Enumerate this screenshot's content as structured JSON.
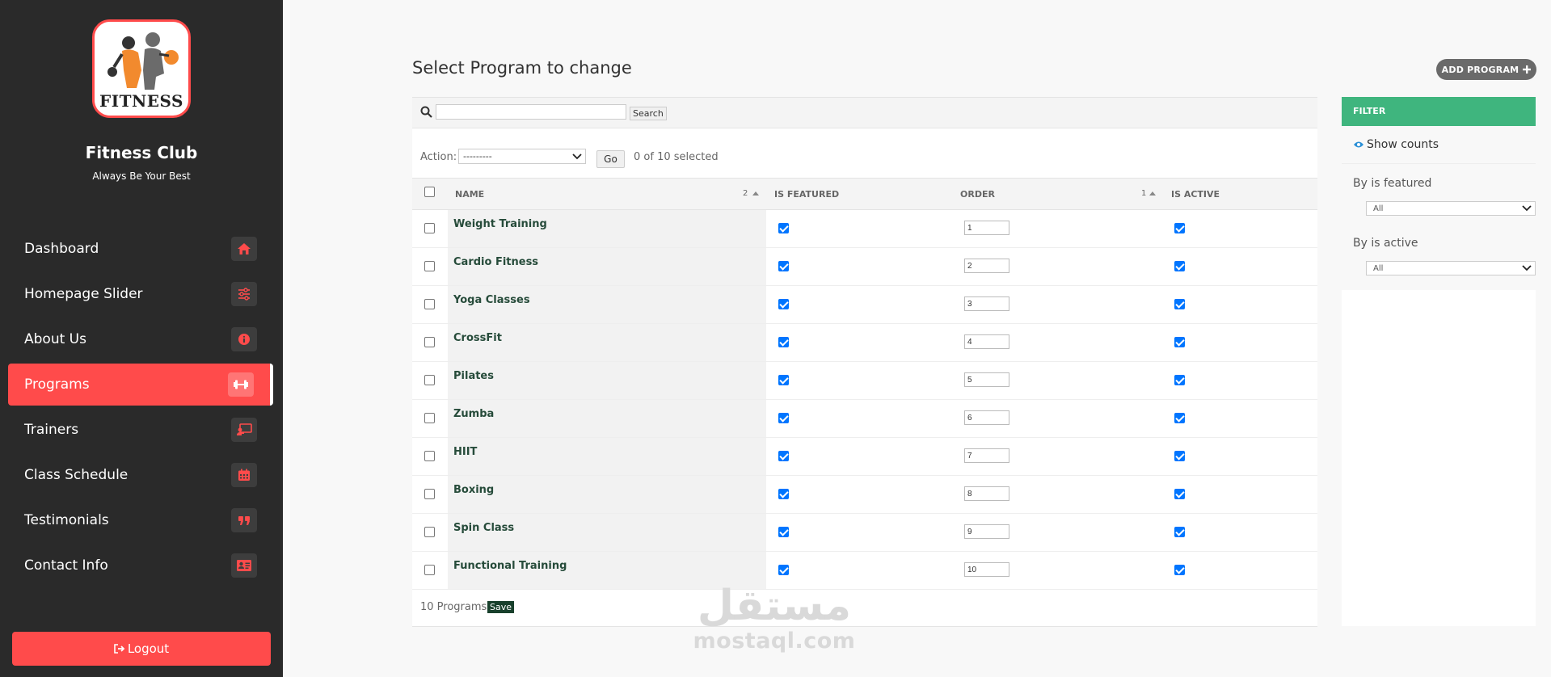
{
  "brand": {
    "name": "Fitness Club",
    "tagline": "Always Be Your Best",
    "logo_text": "FITNESS"
  },
  "colors": {
    "sidebar": "#2a2a2a",
    "accent": "#ff4b4b",
    "filter_header": "#3fb57e",
    "save": "#18402c"
  },
  "nav": {
    "items": [
      {
        "label": "Dashboard",
        "icon": "home-icon"
      },
      {
        "label": "Homepage Slider",
        "icon": "sliders-icon"
      },
      {
        "label": "About Us",
        "icon": "info-icon"
      },
      {
        "label": "Programs",
        "icon": "dumbbell-icon",
        "active": true
      },
      {
        "label": "Trainers",
        "icon": "presentation-icon"
      },
      {
        "label": "Class Schedule",
        "icon": "calendar-icon"
      },
      {
        "label": "Testimonials",
        "icon": "quote-icon"
      },
      {
        "label": "Contact Info",
        "icon": "contact-card-icon"
      }
    ],
    "logout": "Logout"
  },
  "main": {
    "title": "Select Program to change",
    "add_button": "ADD PROGRAM",
    "search": {
      "button": "Search",
      "value": ""
    },
    "actions": {
      "label": "Action:",
      "selected_option": "---------",
      "go": "Go",
      "selected_count": "0 of 10 selected"
    },
    "table": {
      "headers": {
        "name": "NAME",
        "name_sort_rank": "2",
        "is_featured": "IS FEATURED",
        "order": "ORDER",
        "order_sort_rank": "1",
        "is_active": "IS ACTIVE"
      },
      "rows": [
        {
          "name": "Weight Training",
          "featured": true,
          "order": "1",
          "active": true
        },
        {
          "name": "Cardio Fitness",
          "featured": true,
          "order": "2",
          "active": true
        },
        {
          "name": "Yoga Classes",
          "featured": true,
          "order": "3",
          "active": true
        },
        {
          "name": "CrossFit",
          "featured": true,
          "order": "4",
          "active": true
        },
        {
          "name": "Pilates",
          "featured": true,
          "order": "5",
          "active": true
        },
        {
          "name": "Zumba",
          "featured": true,
          "order": "6",
          "active": true
        },
        {
          "name": "HIIT",
          "featured": true,
          "order": "7",
          "active": true
        },
        {
          "name": "Boxing",
          "featured": true,
          "order": "8",
          "active": true
        },
        {
          "name": "Spin Class",
          "featured": true,
          "order": "9",
          "active": true
        },
        {
          "name": "Functional Training",
          "featured": true,
          "order": "10",
          "active": true
        }
      ],
      "footer_count": "10 Programs",
      "save": "Save"
    }
  },
  "filter": {
    "title": "FILTER",
    "show_counts": "Show counts",
    "by_featured_label": "By is featured",
    "by_featured_value": "All",
    "by_active_label": "By is active",
    "by_active_value": "All"
  },
  "watermark": {
    "arabic": "مستقل",
    "latin": "mostaql.com"
  }
}
